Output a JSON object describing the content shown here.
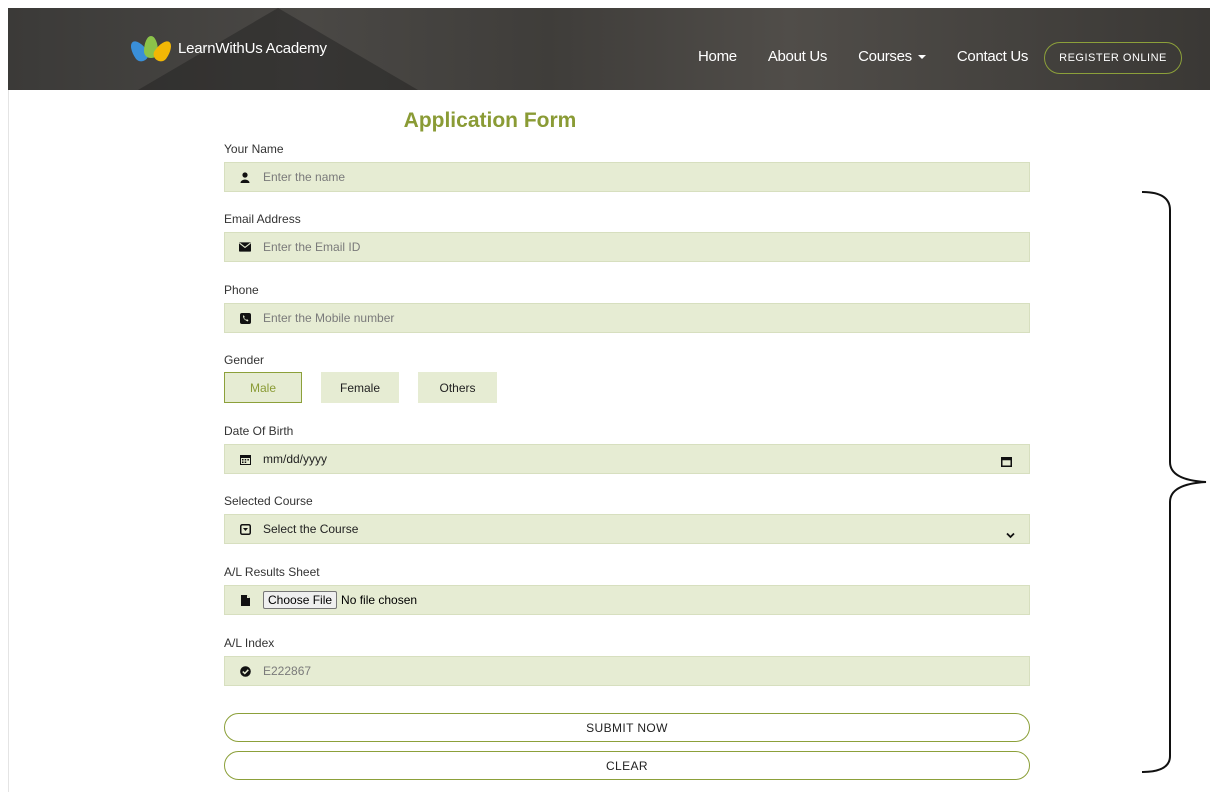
{
  "navbar": {
    "brand": "LearnWithUs Academy",
    "links": [
      {
        "label": "Home"
      },
      {
        "label": "About Us"
      },
      {
        "label": "Courses"
      },
      {
        "label": "Contact Us"
      }
    ],
    "register_label": "REGISTER ONLINE"
  },
  "form": {
    "title": "Application Form",
    "name": {
      "label": "Your Name",
      "placeholder": "Enter the name",
      "icon": "user-icon"
    },
    "email": {
      "label": "Email Address",
      "placeholder": "Enter the Email ID",
      "icon": "envelope-icon"
    },
    "phone": {
      "label": "Phone",
      "placeholder": "Enter the Mobile number",
      "icon": "phone-icon"
    },
    "gender": {
      "label": "Gender",
      "options": [
        "Male",
        "Female",
        "Others"
      ],
      "selected": "Male"
    },
    "dob": {
      "label": "Date Of Birth",
      "placeholder": "mm/dd/yyyy",
      "icon": "calendar-icon"
    },
    "course": {
      "label": "Selected Course",
      "selected": "Select the Course",
      "icon": "dropdown-box-icon"
    },
    "results": {
      "label": "A/L Results Sheet",
      "button": "Choose File",
      "status": "No file chosen",
      "icon": "file-icon"
    },
    "index": {
      "label": "A/L Index",
      "value": "E222867",
      "icon": "check-circle-icon"
    },
    "submit_label": "SUBMIT NOW",
    "clear_label": "CLEAR"
  },
  "colors": {
    "accent": "#8a9b35",
    "field_bg": "#e6ecd3",
    "navbar_bg": "#42403d"
  }
}
